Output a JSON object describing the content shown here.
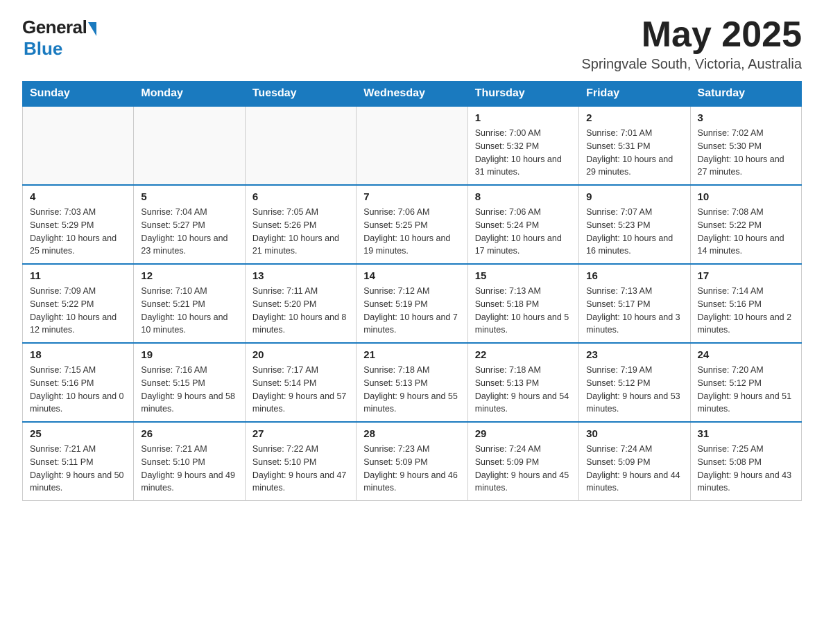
{
  "logo": {
    "general": "General",
    "blue": "Blue"
  },
  "title": {
    "month_year": "May 2025",
    "location": "Springvale South, Victoria, Australia"
  },
  "days_of_week": [
    "Sunday",
    "Monday",
    "Tuesday",
    "Wednesday",
    "Thursday",
    "Friday",
    "Saturday"
  ],
  "weeks": [
    {
      "days": [
        {
          "number": "",
          "info": ""
        },
        {
          "number": "",
          "info": ""
        },
        {
          "number": "",
          "info": ""
        },
        {
          "number": "",
          "info": ""
        },
        {
          "number": "1",
          "info": "Sunrise: 7:00 AM\nSunset: 5:32 PM\nDaylight: 10 hours and 31 minutes."
        },
        {
          "number": "2",
          "info": "Sunrise: 7:01 AM\nSunset: 5:31 PM\nDaylight: 10 hours and 29 minutes."
        },
        {
          "number": "3",
          "info": "Sunrise: 7:02 AM\nSunset: 5:30 PM\nDaylight: 10 hours and 27 minutes."
        }
      ]
    },
    {
      "days": [
        {
          "number": "4",
          "info": "Sunrise: 7:03 AM\nSunset: 5:29 PM\nDaylight: 10 hours and 25 minutes."
        },
        {
          "number": "5",
          "info": "Sunrise: 7:04 AM\nSunset: 5:27 PM\nDaylight: 10 hours and 23 minutes."
        },
        {
          "number": "6",
          "info": "Sunrise: 7:05 AM\nSunset: 5:26 PM\nDaylight: 10 hours and 21 minutes."
        },
        {
          "number": "7",
          "info": "Sunrise: 7:06 AM\nSunset: 5:25 PM\nDaylight: 10 hours and 19 minutes."
        },
        {
          "number": "8",
          "info": "Sunrise: 7:06 AM\nSunset: 5:24 PM\nDaylight: 10 hours and 17 minutes."
        },
        {
          "number": "9",
          "info": "Sunrise: 7:07 AM\nSunset: 5:23 PM\nDaylight: 10 hours and 16 minutes."
        },
        {
          "number": "10",
          "info": "Sunrise: 7:08 AM\nSunset: 5:22 PM\nDaylight: 10 hours and 14 minutes."
        }
      ]
    },
    {
      "days": [
        {
          "number": "11",
          "info": "Sunrise: 7:09 AM\nSunset: 5:22 PM\nDaylight: 10 hours and 12 minutes."
        },
        {
          "number": "12",
          "info": "Sunrise: 7:10 AM\nSunset: 5:21 PM\nDaylight: 10 hours and 10 minutes."
        },
        {
          "number": "13",
          "info": "Sunrise: 7:11 AM\nSunset: 5:20 PM\nDaylight: 10 hours and 8 minutes."
        },
        {
          "number": "14",
          "info": "Sunrise: 7:12 AM\nSunset: 5:19 PM\nDaylight: 10 hours and 7 minutes."
        },
        {
          "number": "15",
          "info": "Sunrise: 7:13 AM\nSunset: 5:18 PM\nDaylight: 10 hours and 5 minutes."
        },
        {
          "number": "16",
          "info": "Sunrise: 7:13 AM\nSunset: 5:17 PM\nDaylight: 10 hours and 3 minutes."
        },
        {
          "number": "17",
          "info": "Sunrise: 7:14 AM\nSunset: 5:16 PM\nDaylight: 10 hours and 2 minutes."
        }
      ]
    },
    {
      "days": [
        {
          "number": "18",
          "info": "Sunrise: 7:15 AM\nSunset: 5:16 PM\nDaylight: 10 hours and 0 minutes."
        },
        {
          "number": "19",
          "info": "Sunrise: 7:16 AM\nSunset: 5:15 PM\nDaylight: 9 hours and 58 minutes."
        },
        {
          "number": "20",
          "info": "Sunrise: 7:17 AM\nSunset: 5:14 PM\nDaylight: 9 hours and 57 minutes."
        },
        {
          "number": "21",
          "info": "Sunrise: 7:18 AM\nSunset: 5:13 PM\nDaylight: 9 hours and 55 minutes."
        },
        {
          "number": "22",
          "info": "Sunrise: 7:18 AM\nSunset: 5:13 PM\nDaylight: 9 hours and 54 minutes."
        },
        {
          "number": "23",
          "info": "Sunrise: 7:19 AM\nSunset: 5:12 PM\nDaylight: 9 hours and 53 minutes."
        },
        {
          "number": "24",
          "info": "Sunrise: 7:20 AM\nSunset: 5:12 PM\nDaylight: 9 hours and 51 minutes."
        }
      ]
    },
    {
      "days": [
        {
          "number": "25",
          "info": "Sunrise: 7:21 AM\nSunset: 5:11 PM\nDaylight: 9 hours and 50 minutes."
        },
        {
          "number": "26",
          "info": "Sunrise: 7:21 AM\nSunset: 5:10 PM\nDaylight: 9 hours and 49 minutes."
        },
        {
          "number": "27",
          "info": "Sunrise: 7:22 AM\nSunset: 5:10 PM\nDaylight: 9 hours and 47 minutes."
        },
        {
          "number": "28",
          "info": "Sunrise: 7:23 AM\nSunset: 5:09 PM\nDaylight: 9 hours and 46 minutes."
        },
        {
          "number": "29",
          "info": "Sunrise: 7:24 AM\nSunset: 5:09 PM\nDaylight: 9 hours and 45 minutes."
        },
        {
          "number": "30",
          "info": "Sunrise: 7:24 AM\nSunset: 5:09 PM\nDaylight: 9 hours and 44 minutes."
        },
        {
          "number": "31",
          "info": "Sunrise: 7:25 AM\nSunset: 5:08 PM\nDaylight: 9 hours and 43 minutes."
        }
      ]
    }
  ]
}
